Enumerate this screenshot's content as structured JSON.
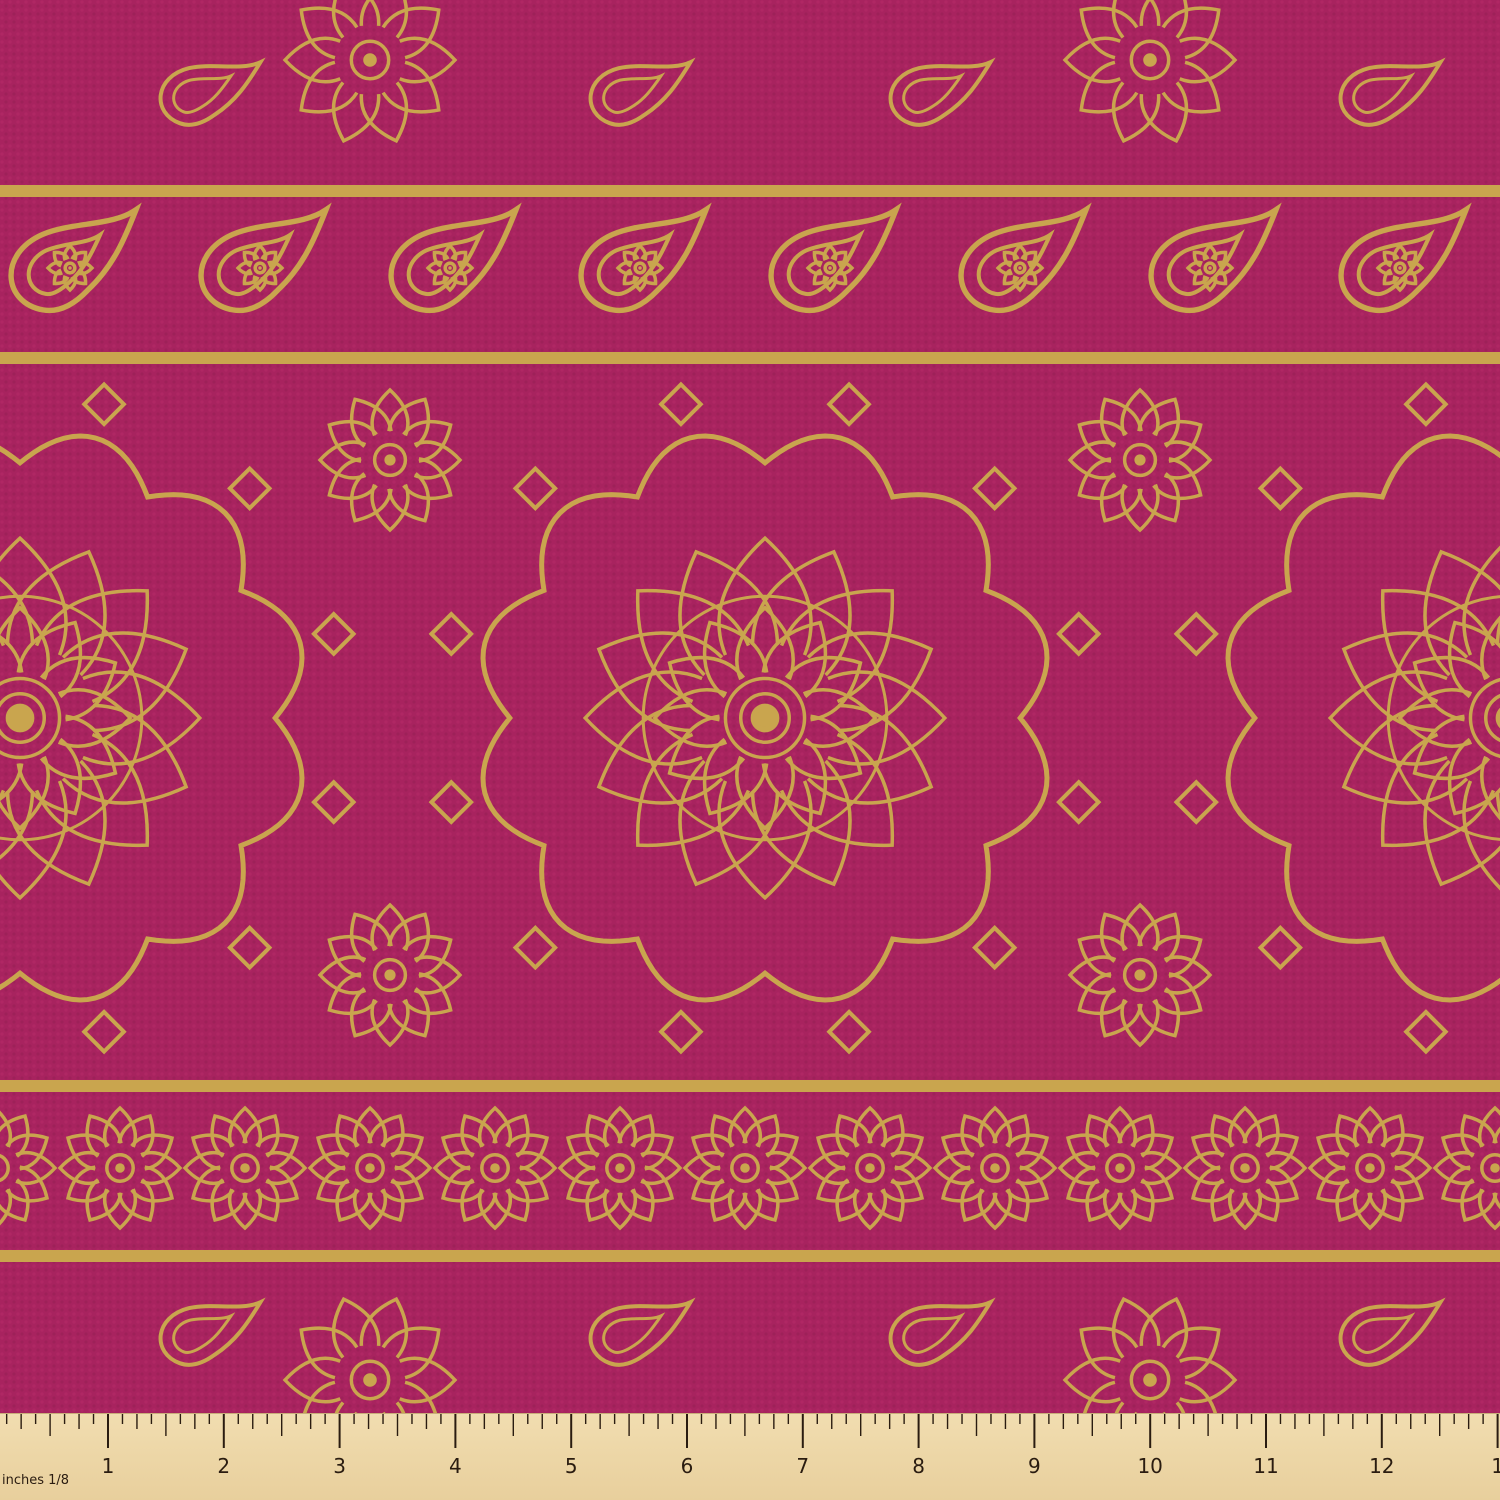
{
  "fabric": {
    "background_color": "#a8235f",
    "motif_color": "#c9a54e",
    "motifs": [
      "paisley-row",
      "gold-stripe",
      "paisley-band",
      "mandala-row",
      "flower-band"
    ]
  },
  "ruler": {
    "unit_label": "inches 1/8",
    "numbers": [
      "1",
      "2",
      "3",
      "4",
      "5",
      "6",
      "7",
      "8",
      "9",
      "10",
      "11",
      "12",
      "1"
    ]
  }
}
